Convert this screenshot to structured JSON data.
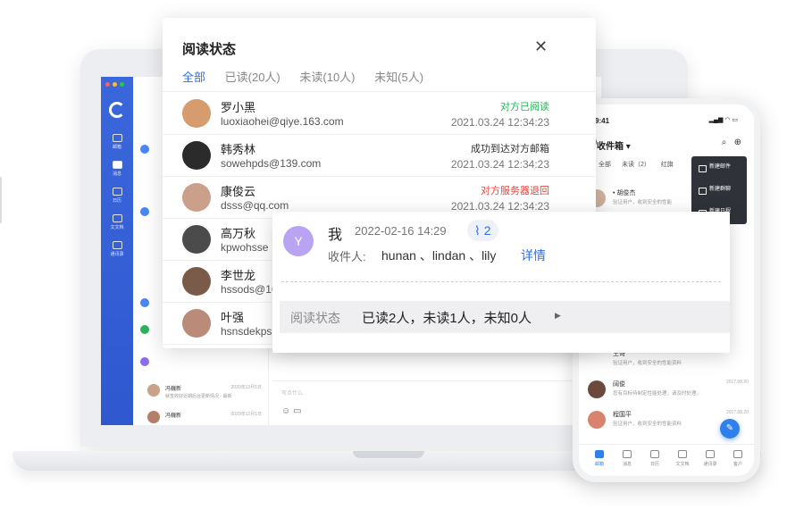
{
  "popup": {
    "title": "阅读状态",
    "tabs": [
      {
        "label": "全部"
      },
      {
        "label": "已读(20人)"
      },
      {
        "label": "未读(10人)"
      },
      {
        "label": "未知(5人)"
      }
    ],
    "rows": [
      {
        "name": "罗小黑",
        "email": "luoxiaohei@qiye.163.com",
        "status": "对方已阅读",
        "status_color": "#2bb35a",
        "time": "2021.03.24 12:34:23"
      },
      {
        "name": "韩秀林",
        "email": "sowehpds@139.com",
        "status": "成功到达对方邮箱",
        "status_color": "#333333",
        "time": "2021.03.24 12:34:23"
      },
      {
        "name": "康俊云",
        "email": "dsss@qq.com",
        "status": "对方服务器退回",
        "status_color": "#e6453c",
        "time": "2021.03.24 12:34:23"
      },
      {
        "name": "高万秋",
        "email": "kpwohsse",
        "status": "",
        "status_color": "#333333",
        "time": ""
      },
      {
        "name": "李世龙",
        "email": "hssods@16",
        "status": "",
        "status_color": "#333333",
        "time": ""
      },
      {
        "name": "叶强",
        "email": "hsnsdekps",
        "status": "",
        "status_color": "#333333",
        "time": ""
      }
    ]
  },
  "message": {
    "avatar_letter": "Y",
    "sender": "我",
    "date": "2022-02-16 14:29",
    "attachment_count": "2",
    "recipients_label": "收件人:",
    "recipients": "hunan 、lindan 、lily",
    "detail_link": "详情",
    "status_label": "阅读状态",
    "status_value": "已读2人，未读1人，未知0人"
  },
  "phone": {
    "time": "9:41",
    "title": "收件箱 ▾",
    "tabs": [
      "全部",
      "未读（2）",
      "红旗"
    ],
    "menu": [
      "新建邮件",
      "新建群聊",
      "新建日程"
    ],
    "rows": [
      {
        "name": "• 胡俊杰",
        "date": "",
        "sub": "验证用户，收到安全的性能",
        "avatar_color": "#d0b39e"
      },
      {
        "name": "王哥",
        "date": "",
        "sub": "验证用户，收到安全的性能资料",
        "avatar_color": "#c08a6c"
      },
      {
        "name": "阔俊",
        "date": "2017.08.20",
        "sub": "您有目标待制定性能处理，请及时处理。",
        "avatar_color": "#6b4a3c"
      },
      {
        "name": "程国平",
        "date": "2017.08.20",
        "sub": "验证用户，收到安全的性能资料",
        "avatar_color": "#d9836e"
      }
    ],
    "nav": [
      "邮箱",
      "消息",
      "日历",
      "文文档",
      "通讯录",
      "客户"
    ]
  },
  "desktop": {
    "list_rows": [
      {
        "name": "冯巍新",
        "date": "2020年12月1日",
        "sub": "就签收好近期后台更新情况 - 最新"
      },
      {
        "name": "冯巍新",
        "date": "2020年12月1日",
        "sub": ""
      }
    ],
    "compose_placeholder": "写点什么",
    "side_nav": [
      "邮箱",
      "消息",
      "日历",
      "文文档",
      "通讯录"
    ]
  },
  "colors": {
    "accent": "#2f6fdd",
    "sidebar": "#3b67dc",
    "read": "#2bb35a",
    "bounced": "#e6453c"
  }
}
